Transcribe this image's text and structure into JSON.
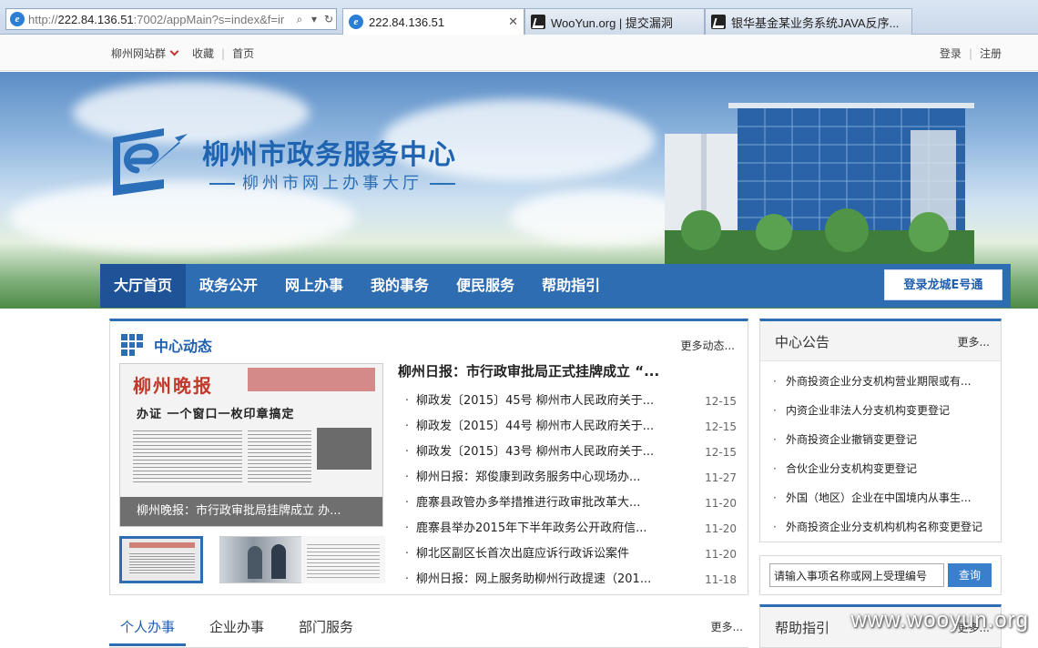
{
  "browser": {
    "url_prefix": "http://",
    "url_host": "222.84.136.51",
    "url_rest": ":7002/appMain?s=index&f=ir",
    "tabs": [
      {
        "title": "222.84.136.51",
        "icon": "ie-icon",
        "active": true,
        "close": "✕"
      },
      {
        "title": "WooYun.org | 提交漏洞",
        "icon": "wooyun-icon"
      },
      {
        "title": "银华基金某业务系统JAVA反序...",
        "icon": "wooyun-icon"
      }
    ]
  },
  "topbar": {
    "site_group": "柳州网站群",
    "favorite": "收藏",
    "home": "首页",
    "login": "登录",
    "register": "注册"
  },
  "banner": {
    "title": "柳州市政务服务中心",
    "subtitle": "柳州市网上办事大厅"
  },
  "nav": {
    "items": [
      "大厅首页",
      "政务公开",
      "网上办事",
      "我的事务",
      "便民服务",
      "帮助指引"
    ],
    "login_button": "登录龙城E号通"
  },
  "news": {
    "title": "中心动态",
    "more": "更多动态...",
    "photo": {
      "masthead": "柳州晚报",
      "headline": "办证 一个窗口一枚印章搞定",
      "caption": "柳州晚报：市行政审批局挂牌成立 办..."
    },
    "lead": "柳州日报：市行政审批局正式挂牌成立 “...",
    "items": [
      {
        "title": "柳政发〔2015〕45号 柳州市人民政府关于...",
        "date": "12-15"
      },
      {
        "title": "柳政发〔2015〕44号 柳州市人民政府关于...",
        "date": "12-15"
      },
      {
        "title": "柳政发〔2015〕43号 柳州市人民政府关于...",
        "date": "12-15"
      },
      {
        "title": "柳州日报：郑俊康到政务服务中心现场办...",
        "date": "11-27"
      },
      {
        "title": "鹿寨县政管办多举措推进行政审批改革大...",
        "date": "11-20"
      },
      {
        "title": "鹿寨县举办2015年下半年政务公开政府信...",
        "date": "11-20"
      },
      {
        "title": "柳北区副区长首次出庭应诉行政诉讼案件",
        "date": "11-20"
      },
      {
        "title": "柳州日报：网上服务助柳州行政提速（201...",
        "date": "11-18"
      }
    ]
  },
  "services": {
    "tabs": [
      "个人办事",
      "企业办事",
      "部门服务"
    ],
    "more": "更多..."
  },
  "notice": {
    "title": "中心公告",
    "more": "更多...",
    "items": [
      "外商投资企业分支机构营业期限或有...",
      "内资企业非法人分支机构变更登记",
      "外商投资企业撤销变更登记",
      "合伙企业分支机构变更登记",
      "外国（地区）企业在中国境内从事生...",
      "外商投资企业分支机构机构名称变更登记"
    ]
  },
  "search": {
    "value": "请输入事项名称或网上受理编号",
    "button": "查询"
  },
  "help": {
    "title": "帮助指引",
    "more": "更多..."
  },
  "watermark": "www.wooyun.org",
  "colors": {
    "primary": "#2e6db2",
    "active_nav": "#1e5497",
    "title_blue": "#1f64b0"
  }
}
